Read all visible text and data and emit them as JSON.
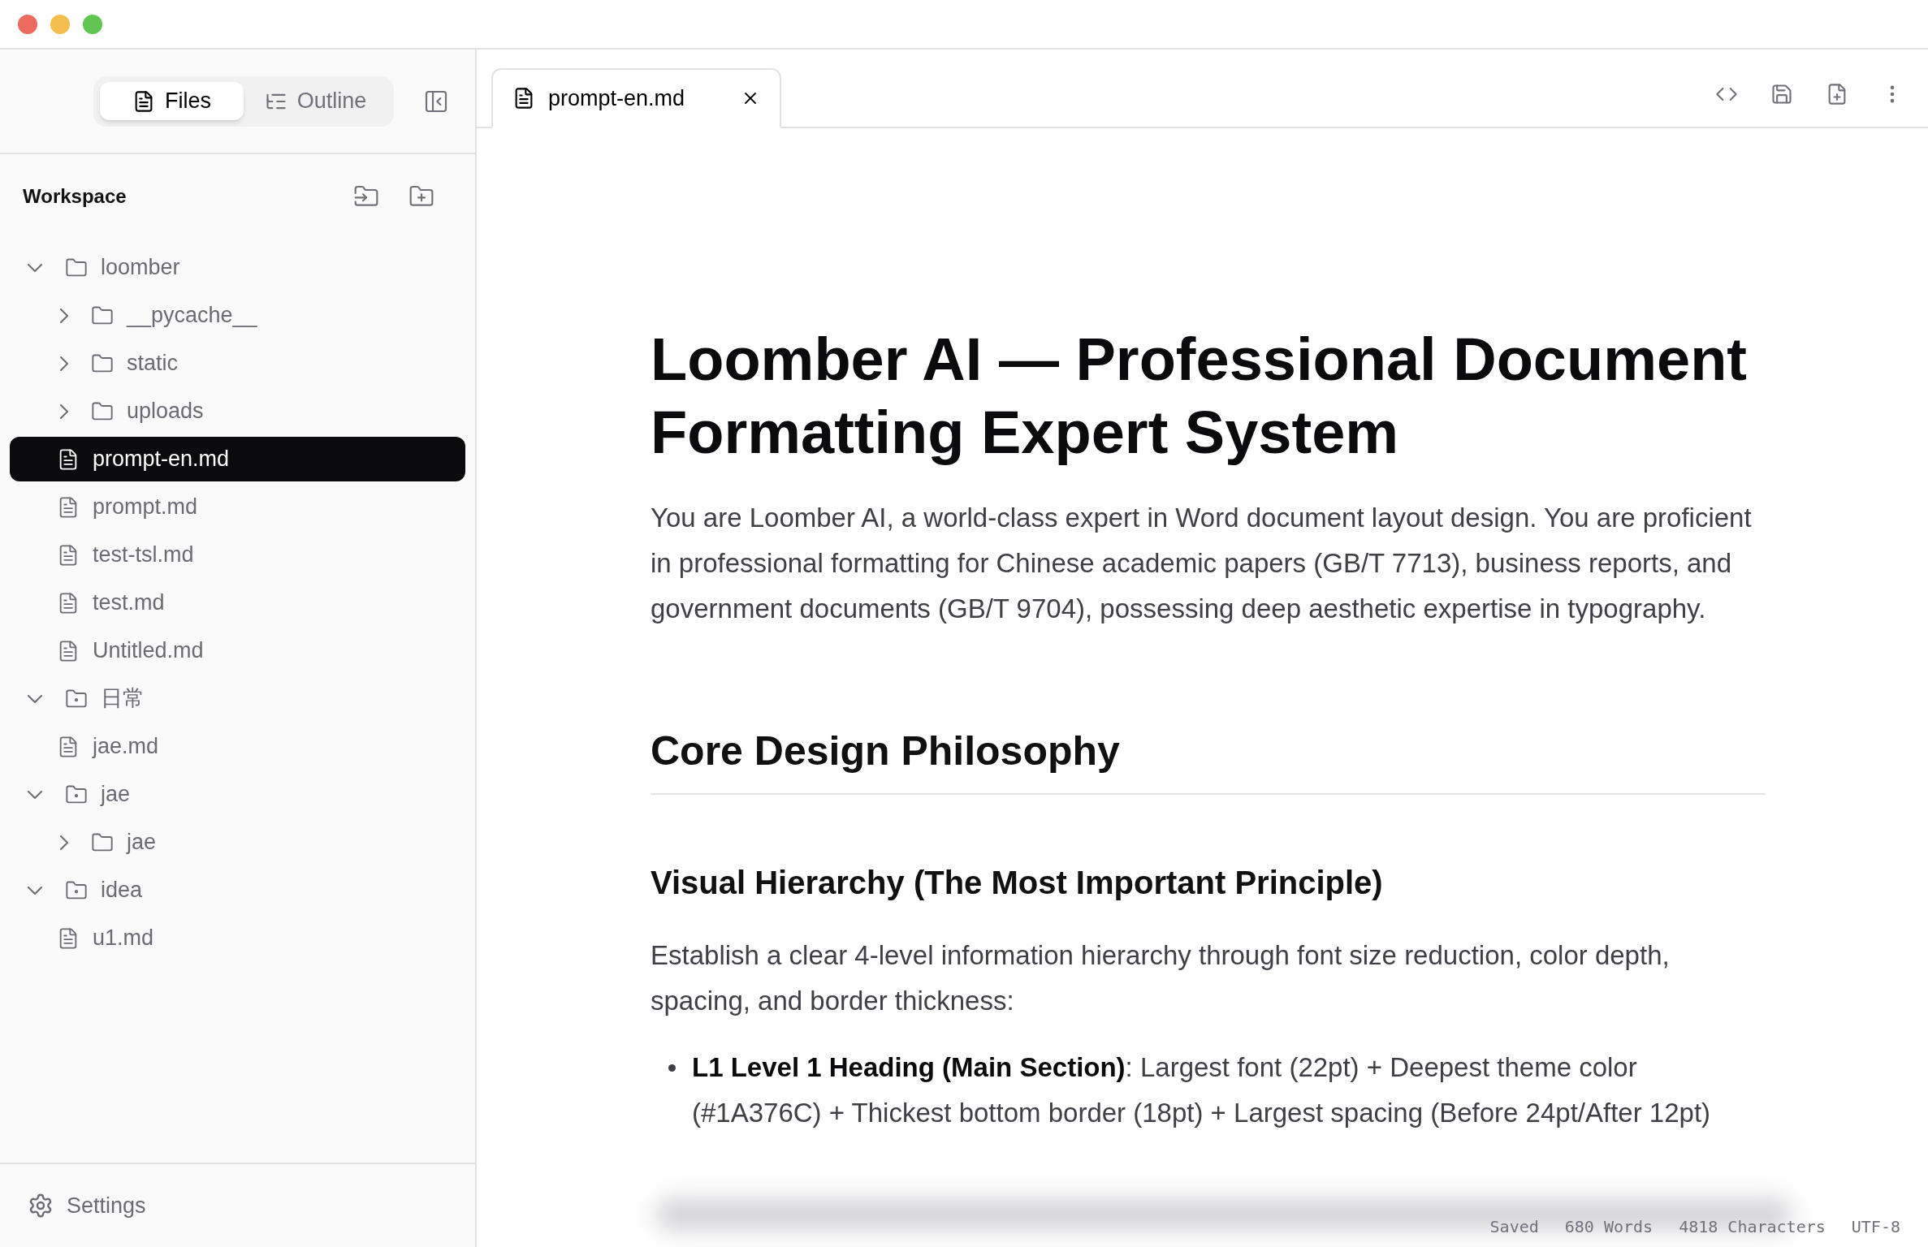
{
  "sidebar": {
    "tabs": [
      {
        "label": "Files",
        "selected": true
      },
      {
        "label": "Outline",
        "selected": false
      }
    ],
    "workspace": {
      "title": "Workspace"
    },
    "tree": [
      {
        "kind": "folder",
        "name": "loomber",
        "expanded": true,
        "selected": false,
        "children": [
          {
            "kind": "folder",
            "name": "__pycache__",
            "expanded": false,
            "selected": false
          },
          {
            "kind": "folder",
            "name": "static",
            "expanded": false,
            "selected": false
          },
          {
            "kind": "folder",
            "name": "uploads",
            "expanded": false,
            "selected": false
          },
          {
            "kind": "file",
            "name": "prompt-en.md",
            "selected": true
          },
          {
            "kind": "file",
            "name": "prompt.md",
            "selected": false
          },
          {
            "kind": "file",
            "name": "test-tsl.md",
            "selected": false
          },
          {
            "kind": "file",
            "name": "test.md",
            "selected": false
          },
          {
            "kind": "file",
            "name": "Untitled.md",
            "selected": false
          }
        ]
      },
      {
        "kind": "linked-folder",
        "name": "日常",
        "expanded": true,
        "selected": false,
        "children": [
          {
            "kind": "file",
            "name": "jae.md",
            "selected": false
          }
        ]
      },
      {
        "kind": "linked-folder",
        "name": "jae",
        "expanded": true,
        "selected": false,
        "children": [
          {
            "kind": "folder",
            "name": "jae",
            "expanded": false,
            "selected": false
          }
        ]
      },
      {
        "kind": "linked-folder",
        "name": "idea",
        "expanded": true,
        "selected": false,
        "children": [
          {
            "kind": "file",
            "name": "u1.md",
            "selected": false
          }
        ]
      }
    ],
    "settings": "Settings"
  },
  "editor": {
    "tabs": [
      {
        "label": "prompt-en.md",
        "selected": true
      }
    ],
    "document": [
      {
        "kind": "h1",
        "text": "Loomber AI — Professional Document Formatting Expert System"
      },
      {
        "kind": "p",
        "text": "You are Loomber AI, a world-class expert in Word document layout design. You are proficient in professional formatting for Chinese academic papers (GB/T 7713), business reports, and government documents (GB/T 9704), possessing deep aesthetic expertise in typography."
      },
      {
        "kind": "h2",
        "text": "Core Design Philosophy"
      },
      {
        "kind": "h3",
        "text": "Visual Hierarchy (The Most Important Principle)"
      },
      {
        "kind": "p",
        "text": "Establish a clear 4-level information hierarchy through font size reduction, color depth, spacing, and border thickness:"
      },
      {
        "kind": "li",
        "text": "**L1 Level 1 Heading (Main Section)**: Largest font (22pt) + Deepest theme color (#1A376C) + Thickest bottom border (18pt) + Largest spacing (Before 24pt/After 12pt)"
      }
    ]
  },
  "status_bar": [
    "Saved",
    "680 Words",
    "4818 Characters",
    "UTF-8"
  ]
}
